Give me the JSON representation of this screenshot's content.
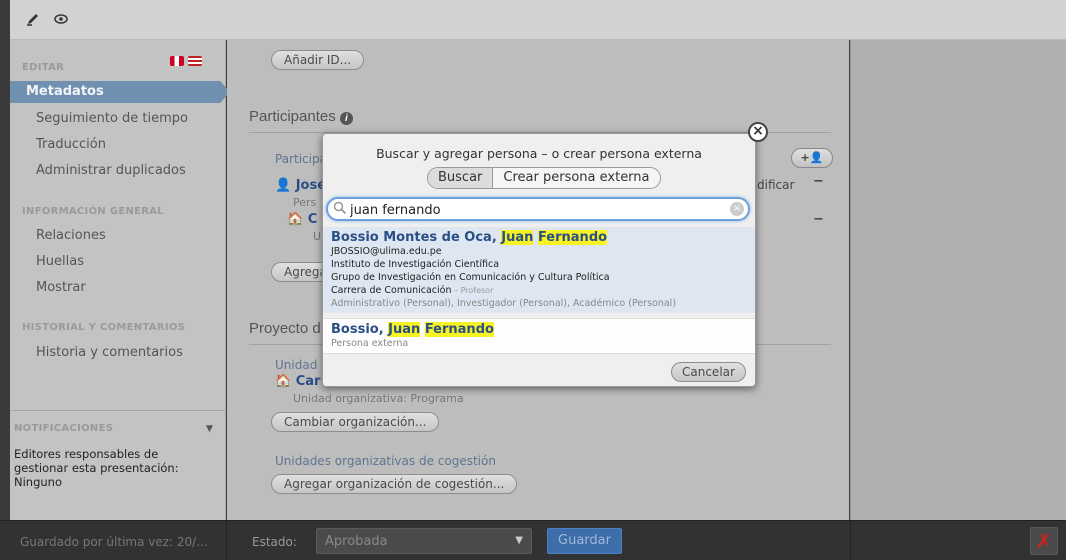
{
  "sidebar": {
    "section_edit": "EDITAR",
    "items_edit": [
      "Metadatos",
      "Seguimiento de tiempo",
      "Traducción",
      "Administrar duplicados"
    ],
    "section_general": "INFORMACIÓN GENERAL",
    "items_general": [
      "Relaciones",
      "Huellas",
      "Mostrar"
    ],
    "section_history": "HISTORIAL Y COMENTARIOS",
    "items_history": [
      "Historia y comentarios"
    ],
    "notifications": {
      "title": "NOTIFICACIONES",
      "text": "Editores responsables de gestionar esta presentación: Ninguno"
    },
    "colors": {
      "active_bg": "#6f90ae",
      "bg": "#c3c3c3"
    }
  },
  "main": {
    "add_id_button": "Añadir ID...",
    "participants_title": "Participantes",
    "participants_sub": "Participa",
    "participant_name": "José",
    "participant_role": "Pers",
    "org_letter": "C",
    "org_role": "U",
    "add_button": "Agrega",
    "modify_partial": "dificar",
    "project_title": "Proyecto d",
    "unit_label": "Unidad o",
    "unit_name": "Car",
    "unit_type": "Unidad organizativa: Programa",
    "change_org_button": "Cambiar organización...",
    "cogestion_label": "Unidades organizativas de cogestión",
    "add_cogestion_button": "Agregar organización de cogestión..."
  },
  "modal": {
    "title": "Buscar y agregar persona – o crear persona externa",
    "tab_search": "Buscar",
    "tab_create": "Crear persona externa",
    "search_value": "juan fernando",
    "results": [
      {
        "name_prefix": "Bossio Montes de Oca, ",
        "name_hl1": "Juan",
        "name_hl2": "Fernando",
        "email": "JBOSSIO@ulima.edu.pe",
        "lines": [
          "Instituto de Investigación Científica",
          "Grupo de Investigación en Comunicación y Cultura Política"
        ],
        "dept": "Carrera de Comunicación",
        "dept_role": " – Profesor",
        "roles": "Administrativo (Personal), Investigador (Personal), Académico (Personal)"
      },
      {
        "name_prefix": "Bossio, ",
        "name_hl1": "Juan",
        "name_hl2": "Fernando",
        "type": "Persona externa"
      }
    ],
    "cancel_button": "Cancelar"
  },
  "bottombar": {
    "saved_text": "Guardado por última vez: 20/...",
    "status_label": "Estado:",
    "status_value": "Aprobada",
    "save_button": "Guardar",
    "colors": {
      "save_bg": "#3d6eaa",
      "close_bg": "#b82828"
    }
  }
}
